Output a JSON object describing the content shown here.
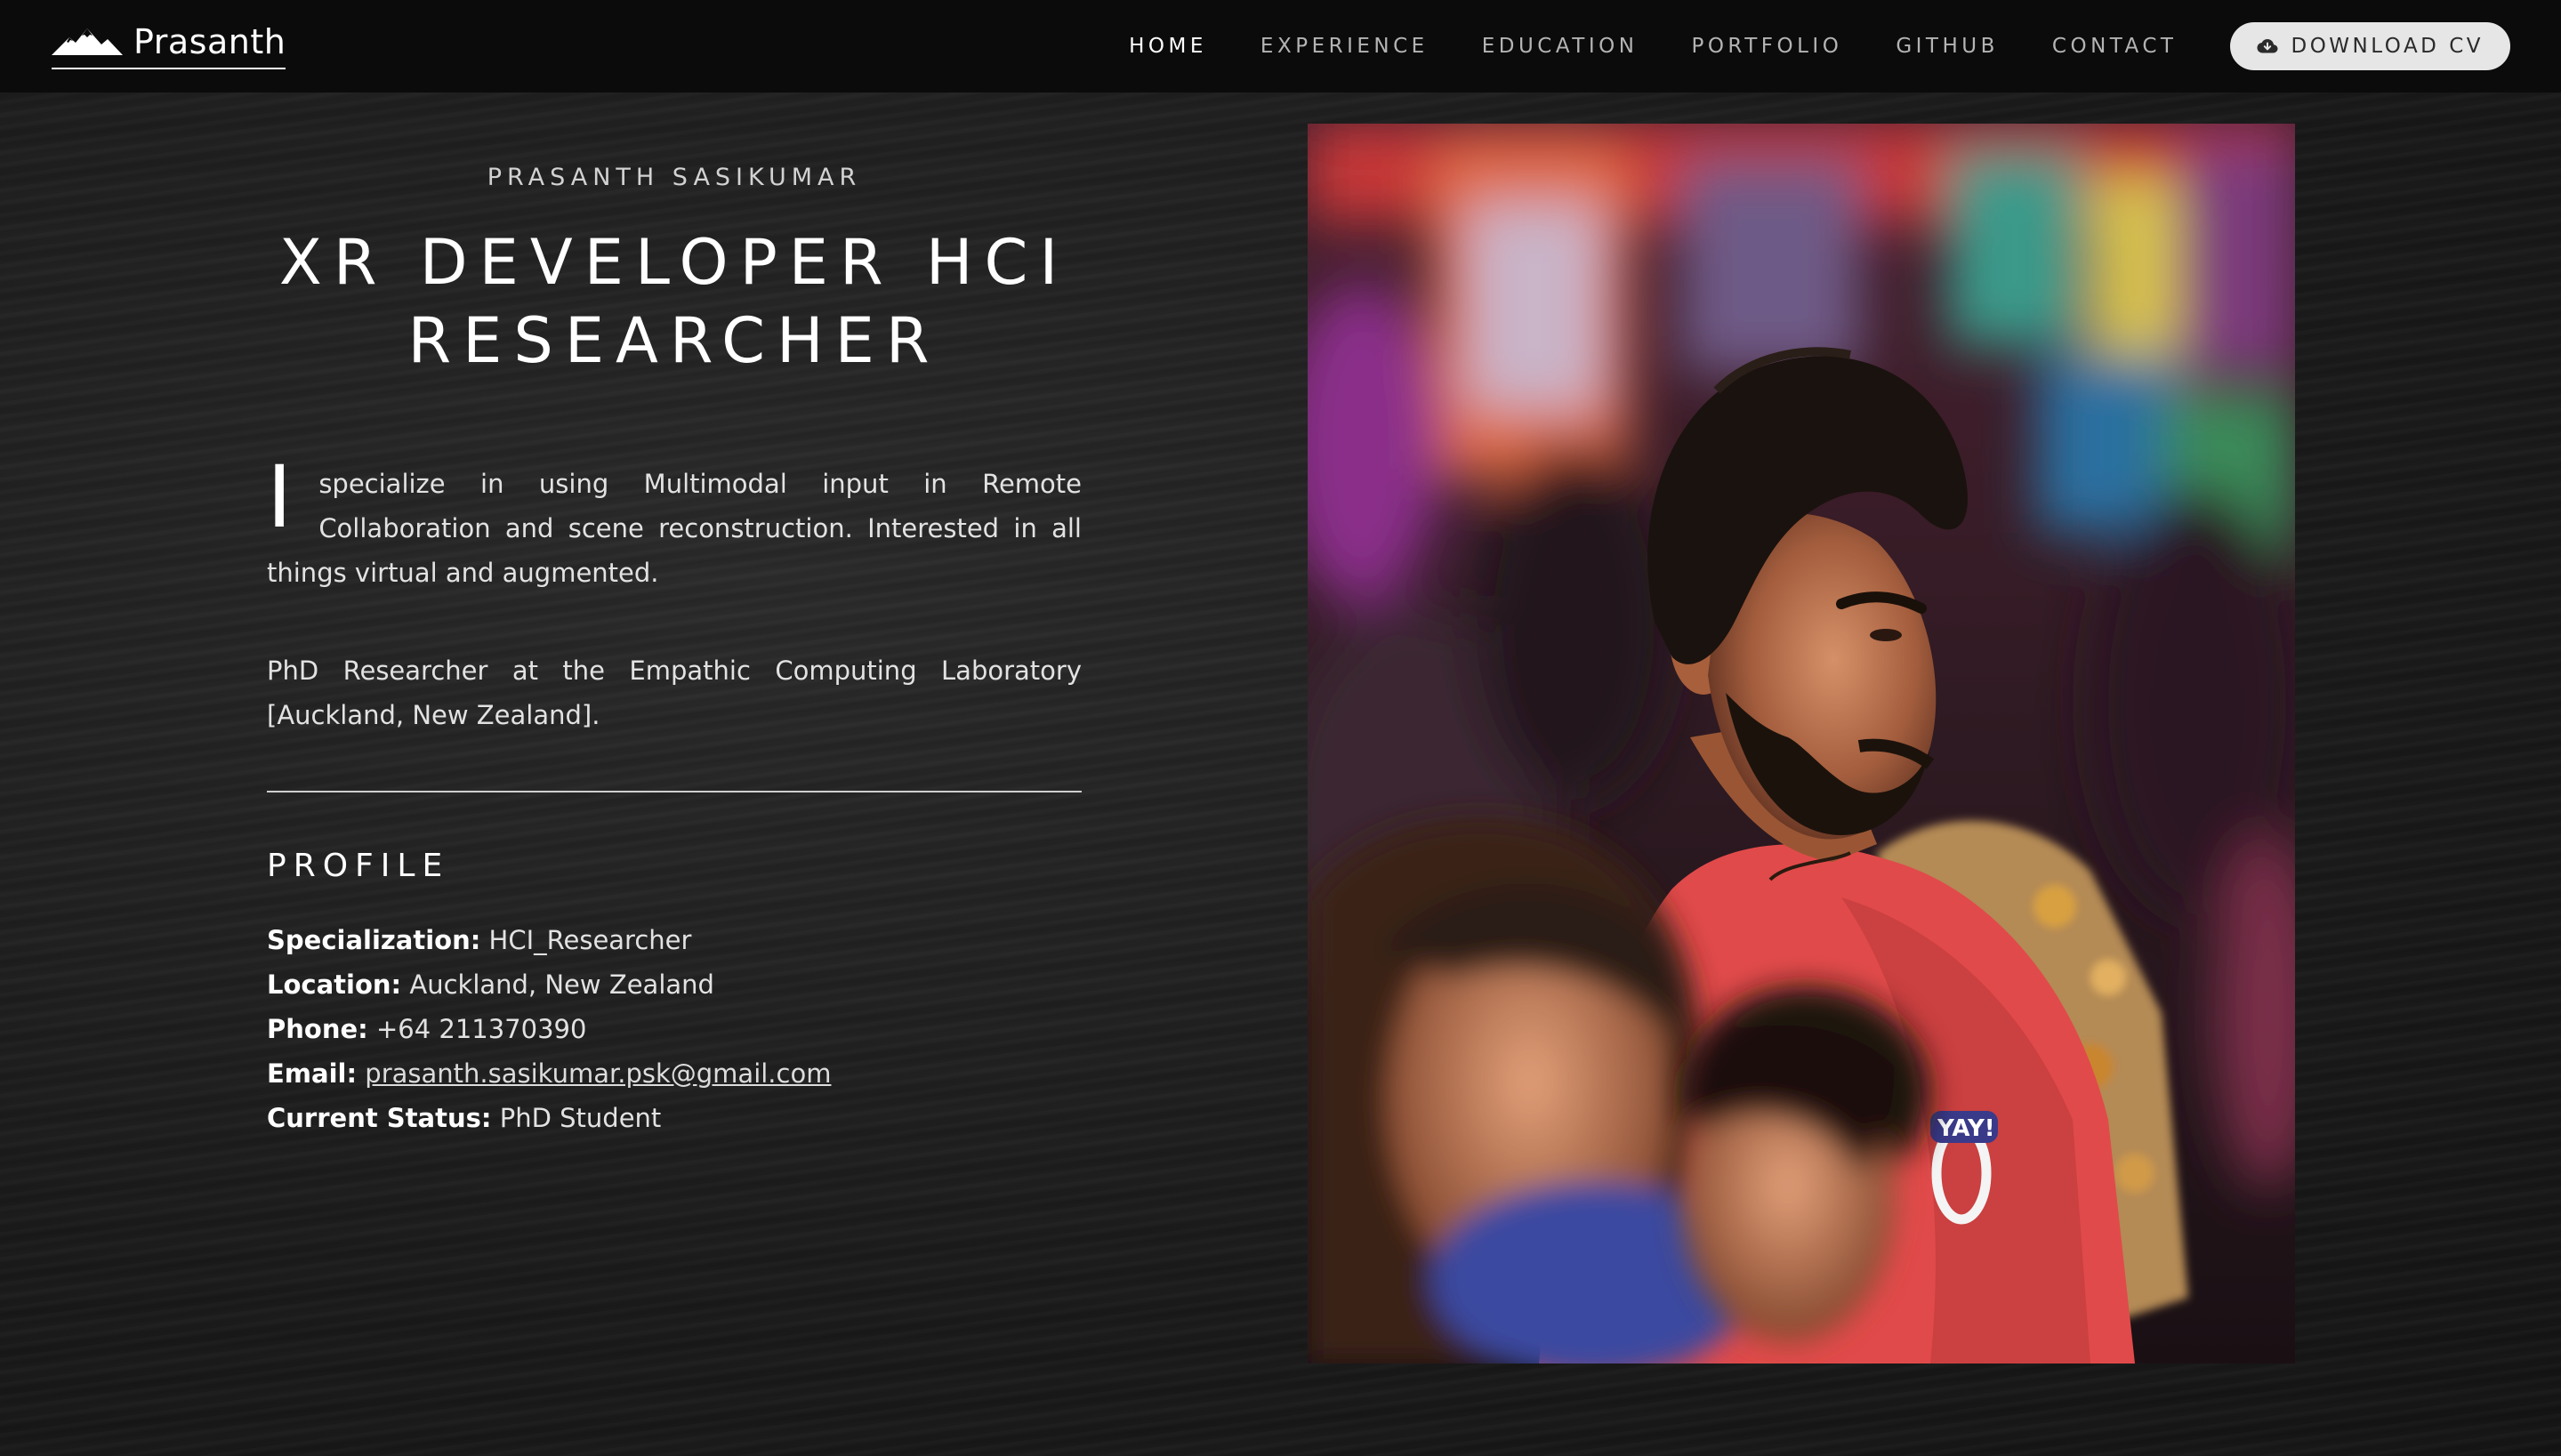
{
  "brand": {
    "name": "Prasanth",
    "logo_icon": "mountain-icon"
  },
  "nav": {
    "items": [
      {
        "label": "HOME",
        "active": true
      },
      {
        "label": "EXPERIENCE",
        "active": false
      },
      {
        "label": "EDUCATION",
        "active": false
      },
      {
        "label": "PORTFOLIO",
        "active": false
      },
      {
        "label": "GITHUB",
        "active": false
      },
      {
        "label": "CONTACT",
        "active": false
      }
    ],
    "cv_button": {
      "label": "DOWNLOAD CV",
      "icon": "cloud-download-icon"
    }
  },
  "hero": {
    "name": "PRASANTH SASIKUMAR",
    "title_line1": "XR DEVELOPER HCI",
    "title_line2": "RESEARCHER",
    "intro_dropcap": "I",
    "intro_rest": "specialize in using Multimodal input in Remote Collaboration and scene reconstruction. Interested in all things virtual and augmented.",
    "affiliation": "PhD Researcher at the Empathic Computing Laboratory [Auckland, New Zealand]."
  },
  "profile": {
    "heading": "PROFILE",
    "rows": [
      {
        "label": "Specialization:",
        "value": "HCI_Researcher"
      },
      {
        "label": "Location:",
        "value": "Auckland, New Zealand"
      },
      {
        "label": "Phone:",
        "value": "+64 211370390"
      },
      {
        "label": "Email:",
        "value": "prasanth.sasikumar.psk@gmail.com"
      },
      {
        "label": "Current Status:",
        "value": "PhD Student"
      }
    ]
  },
  "colors": {
    "navbar_bg": "#0b0b0b",
    "page_bg": "#1c1c1c",
    "cv_button_bg": "#e6e6e6",
    "shirt_red": "#e14a4a"
  }
}
